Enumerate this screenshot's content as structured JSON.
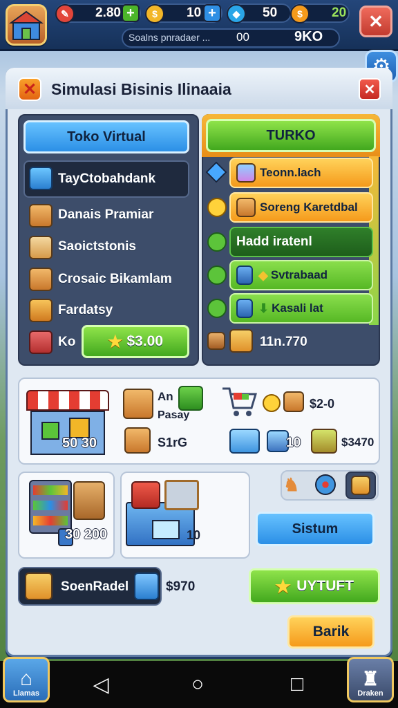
{
  "topbar": {
    "res1_value": "2.80",
    "res2_value": "10",
    "res3_value": "50",
    "res4_value": "20",
    "info_text": "Soalns pnradaer ...",
    "info_count": "00",
    "info_total": "9KO"
  },
  "panel": {
    "title": "Simulasi Bisinis Ilinaaia"
  },
  "left": {
    "tab_label": "Toko Virtual",
    "selected_item": "TayCtobahdank",
    "items": [
      "Danais Pramiar",
      "Saoictstonis",
      "Crosaic Bikamlam",
      "Fardatsy"
    ],
    "ko_label": "Ko",
    "price_button": "$3.00"
  },
  "right": {
    "tab_label": "TURKO",
    "rows": [
      "Teonn.lach",
      "Soreng Karetdbal",
      "Hadd iratenl",
      "Svtrabaad",
      "Kasali lat"
    ],
    "total": "11n.770"
  },
  "shop_card": {
    "stall_price": "50 30",
    "item1_label_line1": "An",
    "item1_label_line2": "Pasay",
    "item2_label": "S1rG",
    "price_right": "$2-0",
    "count_cart": "10",
    "price_far": "$3470"
  },
  "card2": {
    "value": "30 200"
  },
  "card3": {
    "value": "10"
  },
  "system_button": "Sistum",
  "bottom": {
    "resource_label": "SoenRadel",
    "resource_value": "$970",
    "upgrade_button": "UYTUFT",
    "back_button": "Barik"
  },
  "nav": {
    "left_label": "Llamas",
    "right_label": "Draken"
  }
}
